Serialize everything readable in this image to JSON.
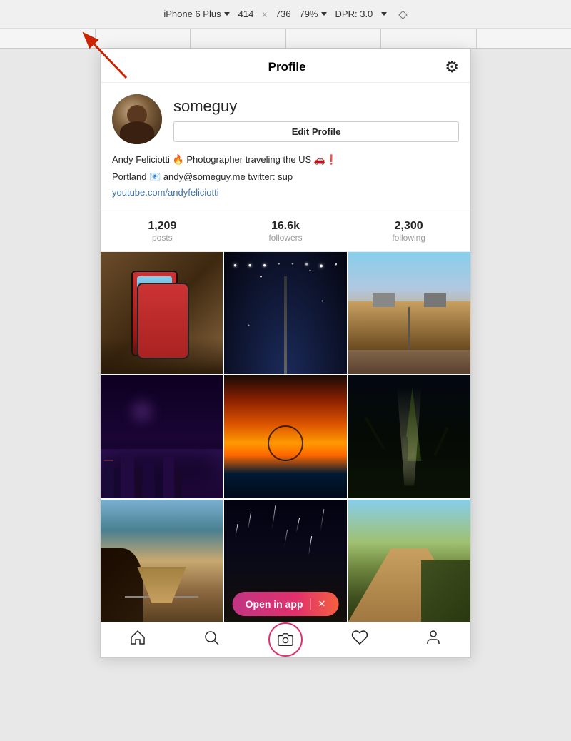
{
  "browser_bar": {
    "device": "iPhone 6 Plus",
    "width": "414",
    "height": "736",
    "zoom": "79%",
    "dpr": "DPR: 3.0",
    "x_label": "x"
  },
  "profile": {
    "title": "Profile",
    "settings_icon": "⚙",
    "username": "someguy",
    "edit_button": "Edit Profile",
    "bio_line1": "Andy Feliciotti 🔥 Photographer traveling the US 🚗❗",
    "bio_line2": "Portland 📧 andy@someguy.me twitter: sup",
    "bio_link": "youtube.com/andyfeliciotti",
    "stats": {
      "posts": {
        "value": "1,209",
        "label": "posts"
      },
      "followers": {
        "value": "16.6k",
        "label": "followers"
      },
      "following": {
        "value": "2,300",
        "label": "following"
      }
    }
  },
  "open_in_app": {
    "label": "Open in app",
    "close": "✕"
  },
  "bottom_nav": {
    "home": "🏠",
    "search": "🔍",
    "camera": "📷",
    "heart": "♡",
    "profile": "👤"
  }
}
